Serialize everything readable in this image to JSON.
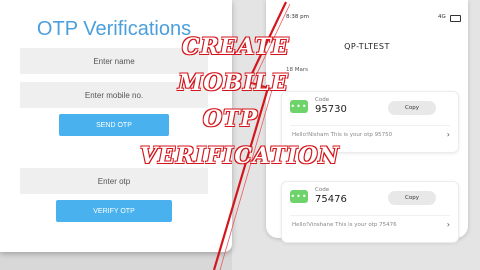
{
  "form": {
    "title": "OTP Verifications",
    "name_placeholder": "Enter name",
    "mobile_placeholder": "Enter mobile no.",
    "send_label": "SEND OTP",
    "otp_placeholder": "Enter otp",
    "verify_label": "VERIFY OTP"
  },
  "phone": {
    "time": "8:38 pm",
    "network": "4G",
    "app_title": "QP-TLTEST",
    "date_label": "18 Mars",
    "cards": [
      {
        "icon_text": "•••",
        "label": "Code",
        "code": "95730",
        "copy_label": "Copy",
        "message": "Hello!Nisham This is your otp 95750"
      },
      {
        "icon_text": "•••",
        "label": "Code",
        "code": "75476",
        "copy_label": "Copy",
        "message": "Hello!Vinshane This is your otp 75476"
      }
    ]
  },
  "overlay": {
    "line1": "CREATE",
    "line2": "MOBILE",
    "line3": "OTP",
    "line4": "VERIFICATION"
  },
  "colors": {
    "accent_blue": "#4a9fdc",
    "button_blue": "#49b1ee",
    "green": "#6dd36a",
    "red": "#d4161c"
  }
}
